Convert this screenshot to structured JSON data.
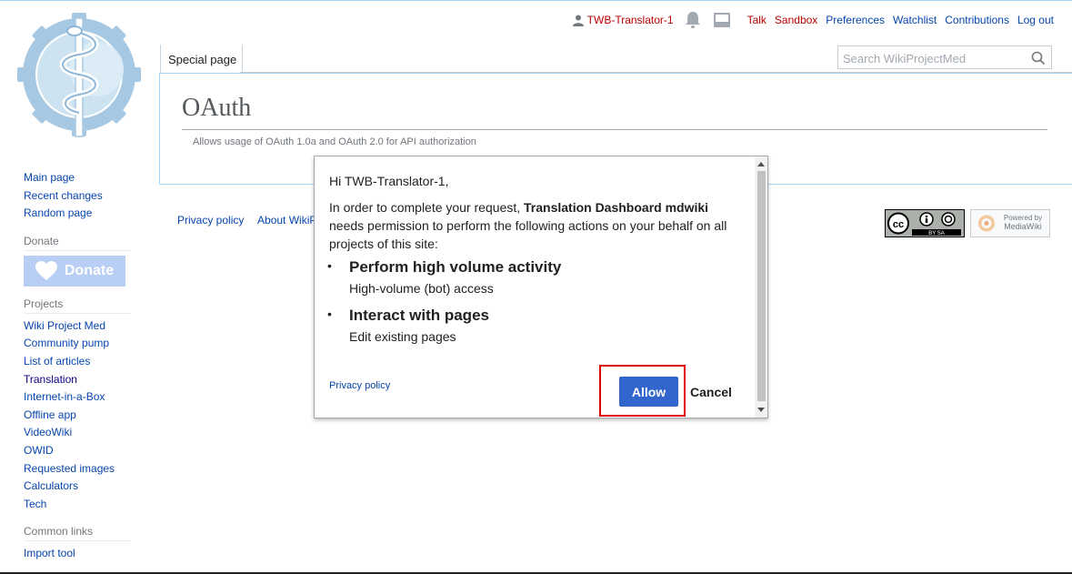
{
  "personal_tools": {
    "username": "TWB-Translator-1",
    "talk": "Talk",
    "sandbox": "Sandbox",
    "preferences": "Preferences",
    "watchlist": "Watchlist",
    "contributions": "Contributions",
    "logout": "Log out"
  },
  "tabs": {
    "special_page": "Special page"
  },
  "search": {
    "placeholder": "Search WikiProjectMed"
  },
  "page": {
    "title": "OAuth",
    "subtitle": "Allows usage of OAuth 1.0a and OAuth 2.0 for API authorization"
  },
  "footer": {
    "privacy": "Privacy policy",
    "about": "About WikiP",
    "cc_label": "BY SA",
    "mw_label_1": "Powered by",
    "mw_label_2": "MediaWiki"
  },
  "sidebar": {
    "nav": [
      "Main page",
      "Recent changes",
      "Random page"
    ],
    "donate_heading": "Donate",
    "donate_button": "Donate",
    "projects_heading": "Projects",
    "projects": [
      "Wiki Project Med",
      "Community pump",
      "List of articles",
      "Translation",
      "Internet-in-a-Box",
      "Offline app",
      "VideoWiki",
      "OWID",
      "Requested images",
      "Calculators",
      "Tech"
    ],
    "common_heading": "Common links",
    "common": [
      "Import tool"
    ]
  },
  "dialog": {
    "greeting": "Hi TWB-Translator-1,",
    "intro_before": "In order to complete your request,",
    "app_name": "Translation Dashboard mdwiki",
    "intro_after": "needs permission to perform the following actions on your behalf on all projects of this site:",
    "permissions": [
      {
        "title": "Perform high volume activity",
        "desc": "High-volume (bot) access"
      },
      {
        "title": "Interact with pages",
        "desc": "Edit existing pages"
      }
    ],
    "privacy_link": "Privacy policy",
    "allow_button": "Allow",
    "cancel_button": "Cancel"
  },
  "colors": {
    "link": "#0645ad",
    "red_link": "#ba0000",
    "allow_bg": "#3366cc",
    "highlight": "#e00000",
    "donate_bg": "#b8cef5"
  }
}
